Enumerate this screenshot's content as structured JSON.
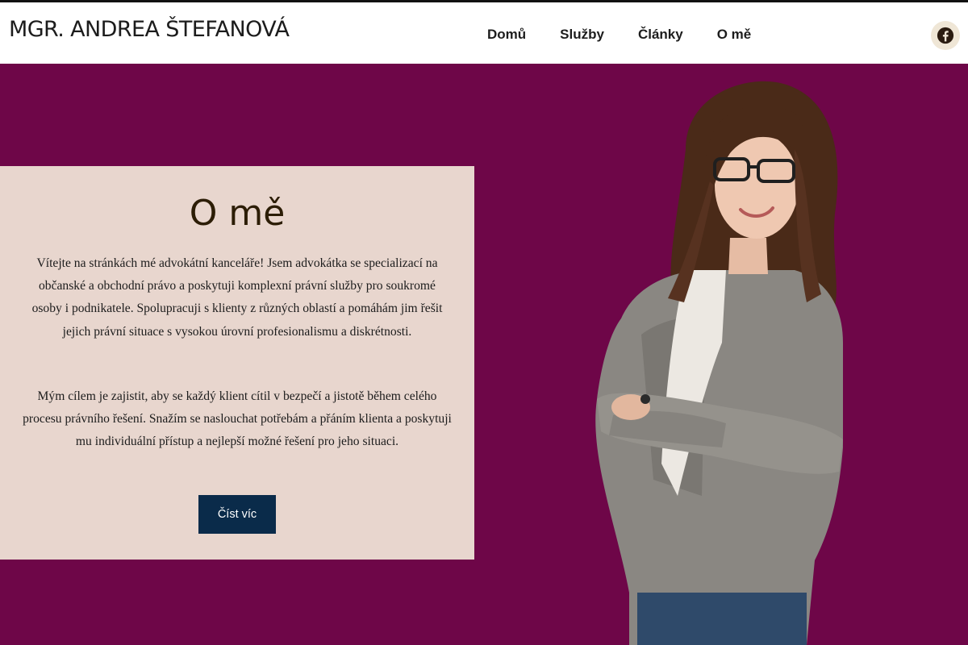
{
  "header": {
    "logo_text": "MGR. ANDREA ŠTEFANOVÁ",
    "nav": [
      {
        "label": "Domů"
      },
      {
        "label": "Služby"
      },
      {
        "label": "Články"
      },
      {
        "label": "O mě"
      }
    ],
    "social_icon": "facebook-icon"
  },
  "about": {
    "title": "O mě",
    "paragraph_1": "Vítejte na stránkách mé advokátní kanceláře! Jsem advokátka se specializací na občanské a obchodní právo a poskytuji komplexní právní služby pro soukromé osoby i podnikatele. Spolupracuji s klienty z různých oblastí a pomáhám jim řešit jejich právní situace s vysokou úrovní profesionalismu a diskrétnosti.",
    "paragraph_2": "Mým cílem je zajistit, aby se každý klient cítil v bezpečí a jistotě během celého procesu právního řešení. Snažím se naslouchat potřebám a přáním klienta a poskytuji mu individuální přístup a nejlepší možné řešení pro jeho situaci.",
    "button_label": "Číst víc"
  },
  "colors": {
    "hero_background": "#6e0648",
    "card_background": "#e8d6ce",
    "button_background": "#0a2b4a",
    "title_color": "#2c1d06",
    "social_background": "#efe6d6"
  }
}
